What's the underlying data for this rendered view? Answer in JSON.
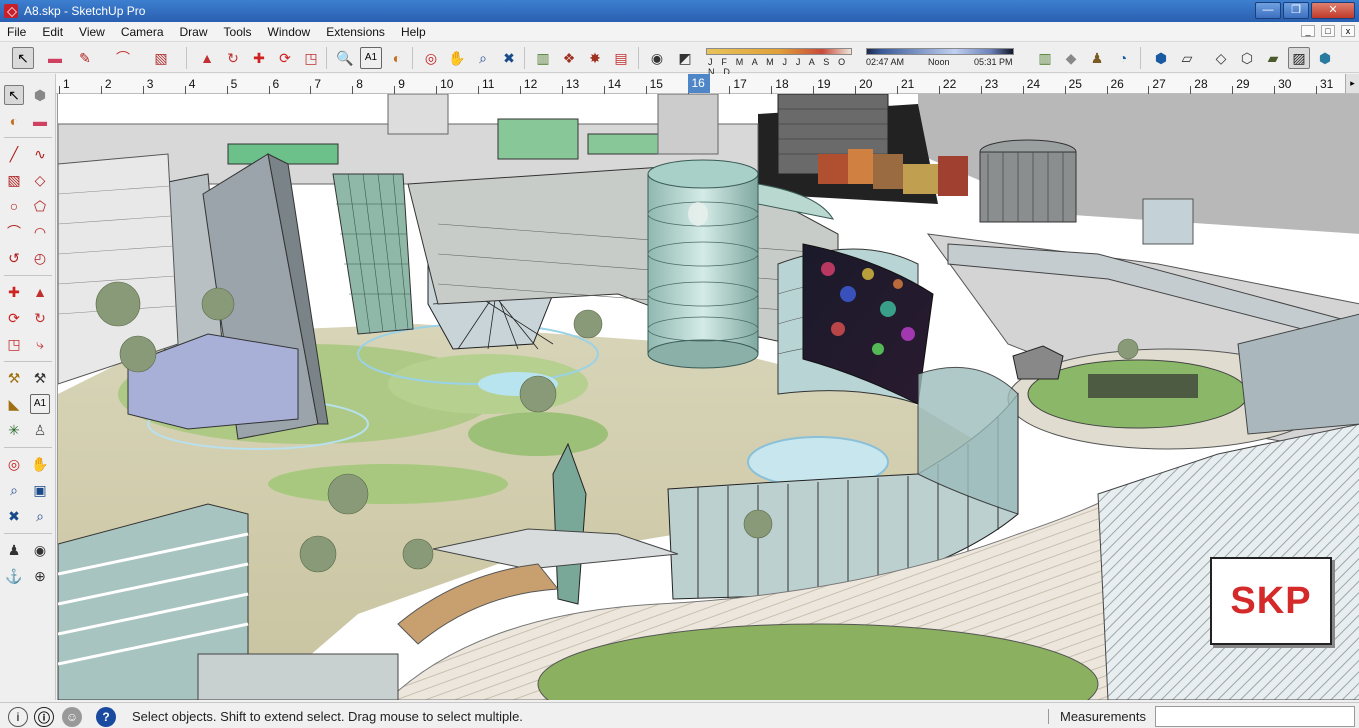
{
  "window": {
    "title": "A8.skp - SketchUp Pro",
    "minimize": "—",
    "restore": "❐",
    "close": "✕"
  },
  "menu": [
    "File",
    "Edit",
    "View",
    "Camera",
    "Draw",
    "Tools",
    "Window",
    "Extensions",
    "Help"
  ],
  "toolbar": {
    "icons": [
      "select-icon",
      "eraser-icon",
      "pencil-icon",
      "arc-icon",
      "rectangle-icon",
      "push-pull-icon",
      "follow-me-icon",
      "move-icon",
      "rotate-icon",
      "scale-icon",
      "tape-measure-icon",
      "text-icon",
      "paint-bucket-icon",
      "orbit-icon",
      "pan-icon",
      "zoom-icon",
      "zoom-extents-icon",
      "previous-view-icon",
      "components-icon",
      "materials-icon",
      "model-info-icon",
      "shadows-icon",
      "fog-icon"
    ],
    "months": "J F M A M J J A S O N D",
    "time_start": "02:47 AM",
    "time_mid": "Noon",
    "time_end": "05:31 PM"
  },
  "ruler": {
    "numbers": [
      "1",
      "2",
      "3",
      "4",
      "5",
      "6",
      "7",
      "8",
      "9",
      "10",
      "11",
      "12",
      "13",
      "14",
      "15",
      "16",
      "17",
      "18",
      "19",
      "20",
      "21",
      "22",
      "23",
      "24",
      "25",
      "26",
      "27",
      "28",
      "29",
      "30",
      "31"
    ],
    "selected": "16"
  },
  "viewport": {
    "badge": "SKP"
  },
  "status": {
    "message": "Select objects. Shift to extend select. Drag mouse to select multiple.",
    "measurements_label": "Measurements",
    "measurements_value": ""
  },
  "colors": {
    "title_bar": "#2a5fb0",
    "selected_tab": "#4f86c8",
    "skp_red": "#d52a2a"
  }
}
